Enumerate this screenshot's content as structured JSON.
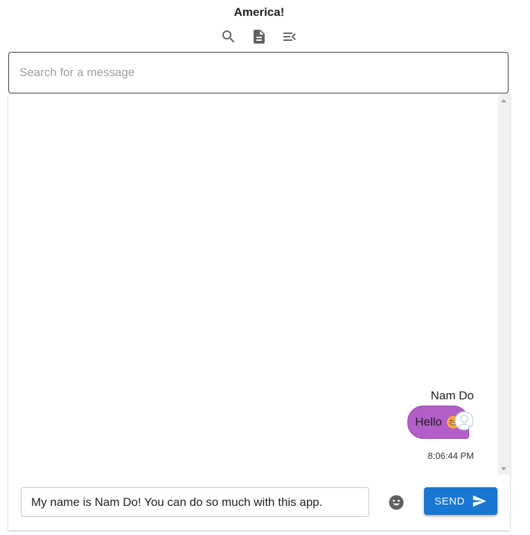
{
  "header": {
    "title": "America!"
  },
  "toolbar": {
    "icons": [
      "search-icon",
      "document-icon",
      "menu-open-icon"
    ]
  },
  "search": {
    "placeholder": "Search for a message"
  },
  "messages": [
    {
      "sender": "Nam Do",
      "text": "Hello",
      "emoji": "grinning-face-with-smiling-eyes",
      "time": "8:06:44 PM",
      "bubble_color": "#b25ec9"
    }
  ],
  "composer": {
    "value": "My name is Nam Do! You can do so much with this app.",
    "send_label": "SEND",
    "send_color": "#1976d2"
  }
}
